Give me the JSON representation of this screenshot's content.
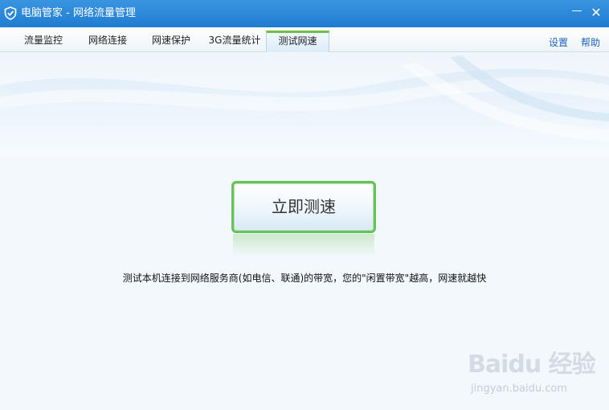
{
  "window": {
    "title": "电脑管家 - 网络流量管理",
    "minimize_glyph": "—",
    "close_glyph": "✕"
  },
  "tabs": [
    {
      "label": "流量监控",
      "active": false
    },
    {
      "label": "网络连接",
      "active": false
    },
    {
      "label": "网速保护",
      "active": false
    },
    {
      "label": "3G流量统计",
      "active": false
    },
    {
      "label": "测试网速",
      "active": true
    }
  ],
  "header_links": {
    "settings": "设置",
    "help": "帮助"
  },
  "main": {
    "test_button": "立即测速",
    "description": "测试本机连接到网络服务商(如电信、联通)的带宽，您的\"闲置带宽\"越高，网速就越快"
  },
  "watermark": {
    "logo_text": "Baidu 经验",
    "url": "jingyan.baidu.com"
  },
  "colors": {
    "titlebar": "#2a88d8",
    "active_tab_accent": "#6cc04a",
    "button_border": "#66c25a",
    "link": "#1f62b8"
  },
  "icons": {
    "app_logo": "shield-check-icon",
    "minimize": "minimize-icon",
    "close": "close-icon"
  }
}
